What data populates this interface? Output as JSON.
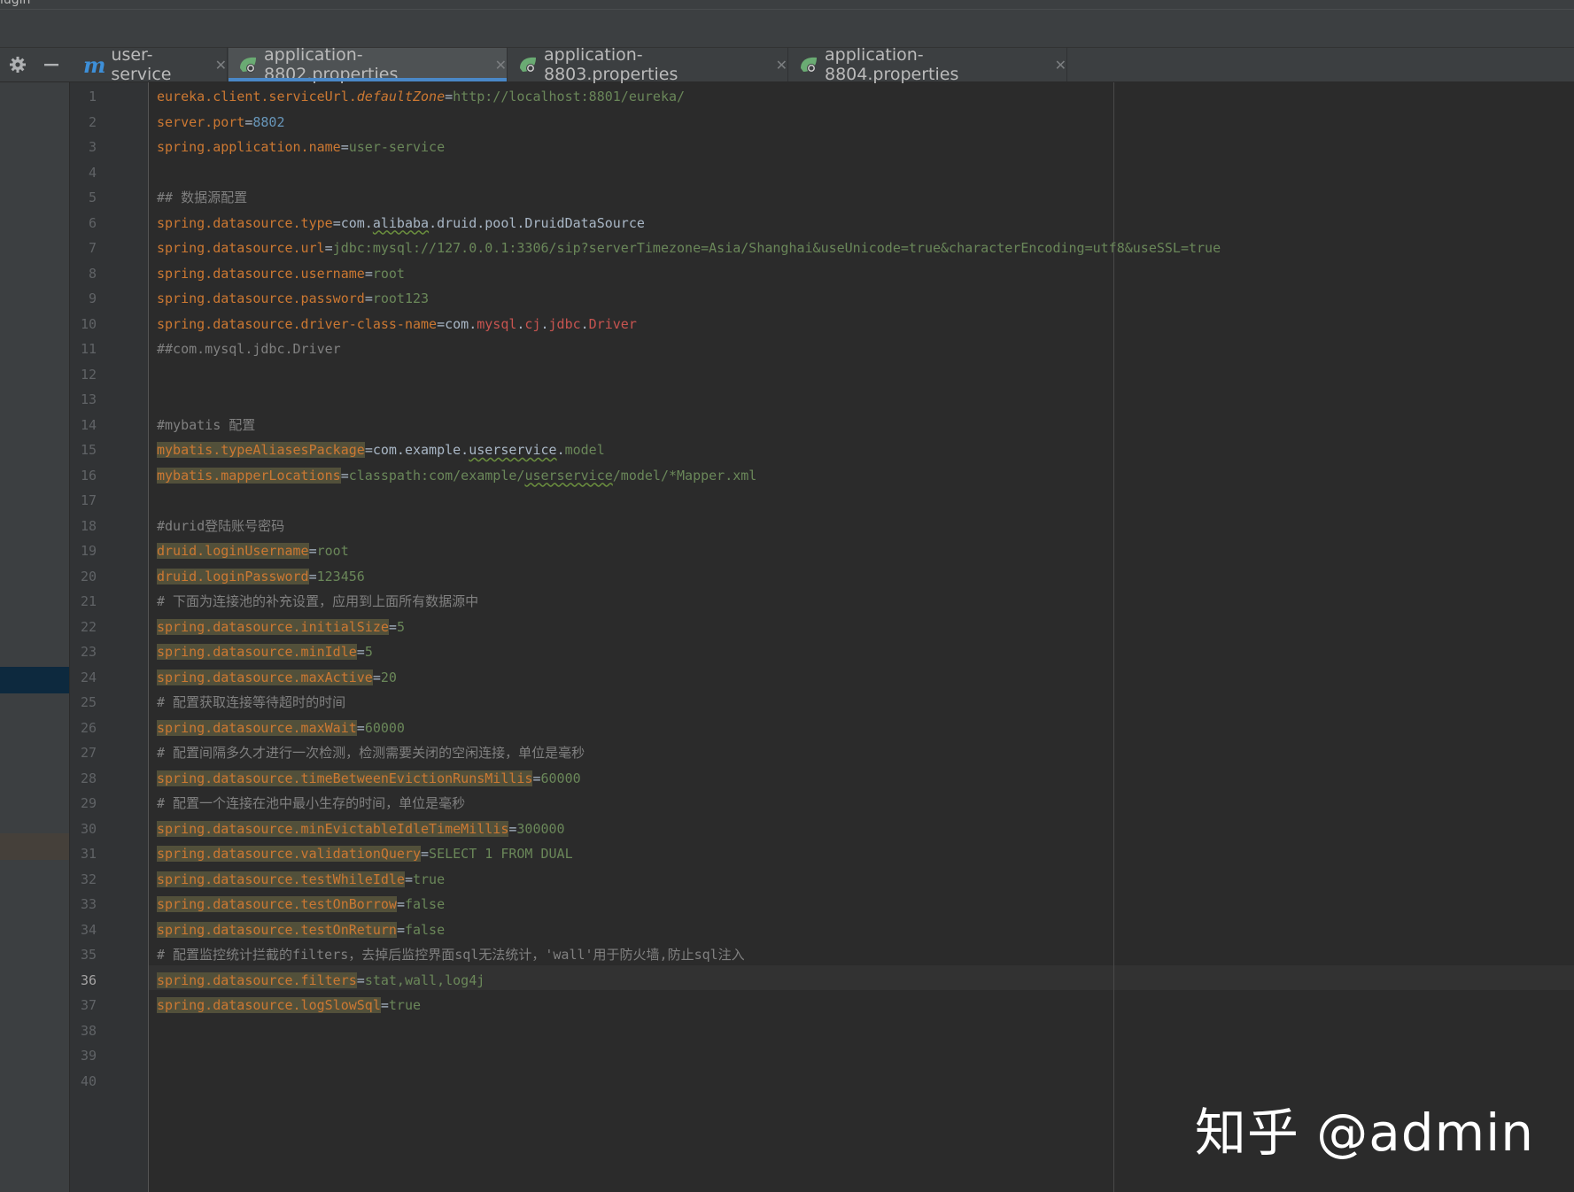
{
  "window": {
    "cut_title": "lugin"
  },
  "toolbar": {
    "settings_icon": "gear-icon",
    "minimize_icon": "minus-icon"
  },
  "tabs": [
    {
      "label": "user-service",
      "icon": "maven-m-icon",
      "active": false
    },
    {
      "label": "application-8802.properties",
      "icon": "spring-properties-icon",
      "active": true
    },
    {
      "label": "application-8803.properties",
      "icon": "spring-properties-icon",
      "active": false
    },
    {
      "label": "application-8804.properties",
      "icon": "spring-properties-icon",
      "active": false
    }
  ],
  "editor": {
    "current_line": 36,
    "lines": [
      {
        "n": "1",
        "k": "eureka.client.serviceUrl.",
        "ki": "defaultZone",
        "e": "=",
        "v": "http://localhost:8801/eureka/"
      },
      {
        "n": "2",
        "k": "server.port",
        "e": "=",
        "vn": "8802"
      },
      {
        "n": "3",
        "k": "spring.application.name",
        "e": "=",
        "v": "user-service"
      },
      {
        "n": "4"
      },
      {
        "n": "5",
        "c": "## 数据源配置"
      },
      {
        "n": "6",
        "k": "spring.datasource.type",
        "e": "=",
        "w1": "com.",
        "ws": "alibaba",
        "w2": ".druid.pool.DruidDataSource"
      },
      {
        "n": "7",
        "k": "spring.datasource.url",
        "e": "=",
        "v": "jdbc:mysql://127.0.0.1:3306/sip?serverTimezone=Asia/Shanghai&useUnicode=true&characterEncoding=utf8&useSSL=true"
      },
      {
        "n": "8",
        "k": "spring.datasource.username",
        "e": "=",
        "v": "root"
      },
      {
        "n": "9",
        "k": "spring.datasource.password",
        "e": "=",
        "v": "root123"
      },
      {
        "n": "10",
        "k": "spring.datasource.driver-class-name",
        "e": "=",
        "w1": "com.",
        "r1": "mysql",
        "d1": ".",
        "r2": "cj",
        "d2": ".",
        "r3": "jdbc",
        "d3": ".",
        "r4": "Driver"
      },
      {
        "n": "11",
        "c": "##com.mysql.jdbc.Driver"
      },
      {
        "n": "12"
      },
      {
        "n": "13"
      },
      {
        "n": "14",
        "c": "#mybatis 配置"
      },
      {
        "n": "15",
        "kh": "mybatis.typeAliasesPackage",
        "e": "=",
        "w1": "com.example.",
        "ws": "userservice",
        "w2": ".",
        "v": "model"
      },
      {
        "n": "16",
        "kh": "mybatis.mapperLocations",
        "e": "=",
        "v1": "classpath:com/example/",
        "vs": "userservice",
        "v": "/model/*Mapper.xml"
      },
      {
        "n": "17"
      },
      {
        "n": "18",
        "c": "#durid登陆账号密码"
      },
      {
        "n": "19",
        "kh": "druid.loginUsername",
        "e": "=",
        "v": "root"
      },
      {
        "n": "20",
        "kh": "druid.loginPassword",
        "e": "=",
        "v": "123456"
      },
      {
        "n": "21",
        "c": "# 下面为连接池的补充设置，应用到上面所有数据源中"
      },
      {
        "n": "22",
        "kh": "spring.datasource.initialSize",
        "e": "=",
        "v": "5"
      },
      {
        "n": "23",
        "kh": "spring.datasource.minIdle",
        "e": "=",
        "v": "5"
      },
      {
        "n": "24",
        "kh": "spring.datasource.maxActive",
        "e": "=",
        "v": "20"
      },
      {
        "n": "25",
        "c": "# 配置获取连接等待超时的时间"
      },
      {
        "n": "26",
        "kh": "spring.datasource.maxWait",
        "e": "=",
        "v": "60000"
      },
      {
        "n": "27",
        "c": "# 配置间隔多久才进行一次检测，检测需要关闭的空闲连接，单位是毫秒"
      },
      {
        "n": "28",
        "kh": "spring.datasource.timeBetweenEvictionRunsMillis",
        "e": "=",
        "v": "60000"
      },
      {
        "n": "29",
        "c": "# 配置一个连接在池中最小生存的时间，单位是毫秒"
      },
      {
        "n": "30",
        "kh": "spring.datasource.minEvictableIdleTimeMillis",
        "e": "=",
        "v": "300000"
      },
      {
        "n": "31",
        "kh": "spring.datasource.validationQuery",
        "e": "=",
        "v": "SELECT 1 FROM DUAL"
      },
      {
        "n": "32",
        "kh": "spring.datasource.testWhileIdle",
        "e": "=",
        "v": "true"
      },
      {
        "n": "33",
        "kh": "spring.datasource.testOnBorrow",
        "e": "=",
        "v": "false"
      },
      {
        "n": "34",
        "kh": "spring.datasource.testOnReturn",
        "e": "=",
        "v": "false"
      },
      {
        "n": "35",
        "c": "# 配置监控统计拦截的filters，去掉后监控界面sql无法统计，'wall'用于防火墙,防止sql注入"
      },
      {
        "n": "36",
        "kh": "spring.datasource.filters",
        "e": "=",
        "v": "stat,wall,log4j"
      },
      {
        "n": "37",
        "kh": "spring.datasource.logSlowSql",
        "e": "=",
        "v": "true"
      },
      {
        "n": "38"
      },
      {
        "n": "39"
      },
      {
        "n": "40"
      }
    ]
  },
  "watermark": "知乎 @admin"
}
